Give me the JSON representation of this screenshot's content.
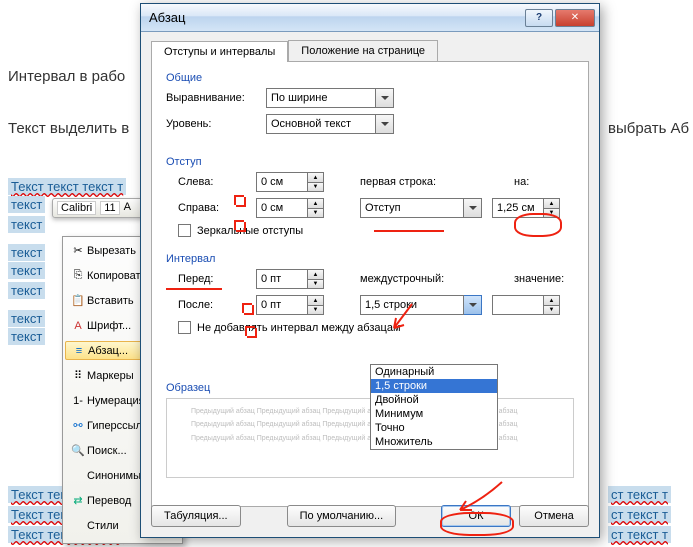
{
  "background": {
    "line1": "Интервал в рабо",
    "line2_left": "Текст выделить в",
    "line2_right": "выбрать  Аб",
    "highlight_rows": [
      "Текст текст текст т",
      "текст",
      "текст",
      "текст",
      "текст",
      "текст",
      "текст",
      "текст"
    ],
    "bottom_rows": [
      "Текст текст текст т",
      "Текст текст текст т",
      "Текст текст текст т"
    ],
    "bottom_rows_right": [
      "ст текст т",
      "ст текст т",
      "ст текст т"
    ]
  },
  "mini_toolbar": {
    "font": "Calibri",
    "size": "11"
  },
  "context_menu": {
    "items": [
      "Вырезать",
      "Копировать",
      "Вставить",
      "Шрифт...",
      "Абзац...",
      "Маркеры",
      "Нумерация",
      "Гиперссылка...",
      "Поиск...",
      "Синонимы",
      "Перевод",
      "Стили"
    ],
    "selected_index": 4
  },
  "dialog": {
    "title": "Абзац",
    "tabs": [
      "Отступы и интервалы",
      "Положение на странице"
    ],
    "active_tab": 0,
    "general": {
      "title": "Общие",
      "align_label": "Выравнивание:",
      "align_value": "По ширине",
      "level_label": "Уровень:",
      "level_value": "Основной текст"
    },
    "indent": {
      "title": "Отступ",
      "left_label": "Слева:",
      "left_value": "0 см",
      "right_label": "Справа:",
      "right_value": "0 см",
      "mirror_label": "Зеркальные отступы",
      "first_line_label": "первая строка:",
      "first_line_value": "Отступ",
      "by_label": "на:",
      "by_value": "1,25 см"
    },
    "spacing": {
      "title": "Интервал",
      "before_label": "Перед:",
      "before_value": "0 пт",
      "after_label": "После:",
      "after_value": "0 пт",
      "line_label": "междустрочный:",
      "line_value": "1,5 строки",
      "at_label": "значение:",
      "at_value": "",
      "no_space_label": "Не добавлять интервал между абзацам",
      "options": [
        "Одинарный",
        "1,5 строки",
        "Двойной",
        "Минимум",
        "Точно",
        "Множитель"
      ],
      "selected_option": 1
    },
    "preview": {
      "title": "Образец",
      "placeholder": "Предыдущий абзац   Предыдущий абзац   Предыдущий абзац   Предыдущий абзац   Предыдущий абзац"
    },
    "buttons": {
      "tabs": "Табуляция...",
      "default": "По умолчанию...",
      "ok": "ОК",
      "cancel": "Отмена"
    }
  }
}
